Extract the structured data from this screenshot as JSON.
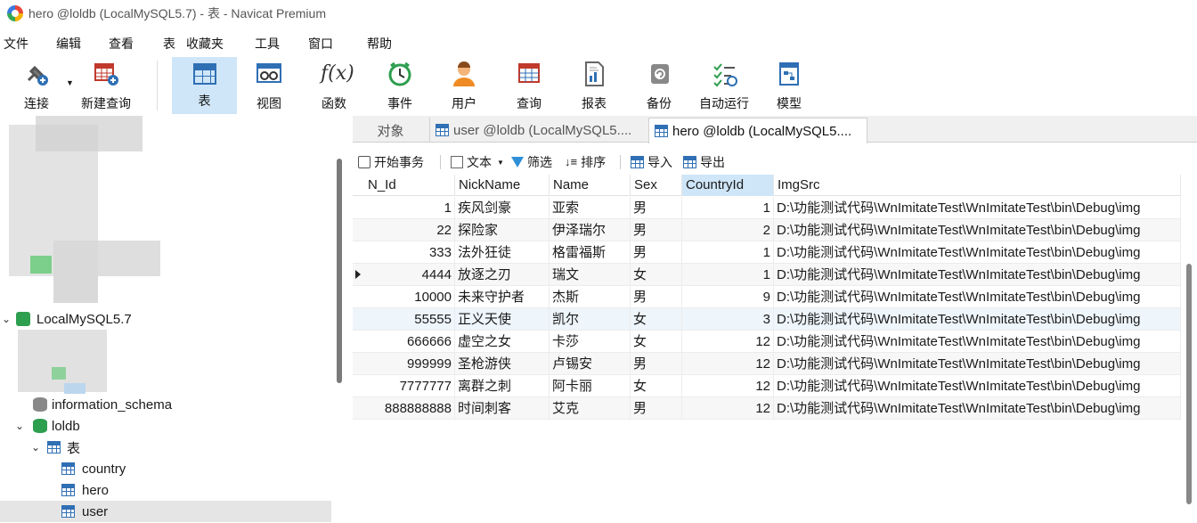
{
  "window": {
    "title": "hero @loldb (LocalMySQL5.7) - 表 - Navicat Premium"
  },
  "menu": [
    "文件",
    "编辑",
    "查看",
    "表",
    "收藏夹",
    "工具",
    "窗口",
    "帮助"
  ],
  "toolbar": [
    {
      "label": "连接",
      "icon": "plug-icon"
    },
    {
      "label": "新建查询",
      "icon": "new-query-icon"
    },
    {
      "label": "表",
      "icon": "table-icon"
    },
    {
      "label": "视图",
      "icon": "view-icon"
    },
    {
      "label": "函数",
      "icon": "function-icon"
    },
    {
      "label": "事件",
      "icon": "clock-icon"
    },
    {
      "label": "用户",
      "icon": "user-icon"
    },
    {
      "label": "查询",
      "icon": "query-icon"
    },
    {
      "label": "报表",
      "icon": "report-icon"
    },
    {
      "label": "备份",
      "icon": "backup-icon"
    },
    {
      "label": "自动运行",
      "icon": "autorun-icon"
    },
    {
      "label": "模型",
      "icon": "model-icon"
    }
  ],
  "tree": {
    "connection": "LocalMySQL5.7",
    "schema1": "information_schema",
    "db": "loldb",
    "tables_folder": "表",
    "tables": [
      "country",
      "hero",
      "user"
    ]
  },
  "tabs": {
    "objects": "对象",
    "tab1": "user @loldb (LocalMySQL5....",
    "tab2": "hero @loldb (LocalMySQL5...."
  },
  "grid_toolbar": {
    "begin_tx": "开始事务",
    "text": "文本",
    "filter": "筛选",
    "sort": "排序",
    "import": "导入",
    "export": "导出"
  },
  "columns": [
    "N_Id",
    "NickName",
    "Name",
    "Sex",
    "CountryId",
    "ImgSrc"
  ],
  "rows": [
    [
      "1",
      "疾风剑豪",
      "亚索",
      "男",
      "1",
      "D:\\功能测试代码\\WnImitateTest\\WnImitateTest\\bin\\Debug\\img"
    ],
    [
      "22",
      "探险家",
      "伊泽瑞尔",
      "男",
      "2",
      "D:\\功能测试代码\\WnImitateTest\\WnImitateTest\\bin\\Debug\\img"
    ],
    [
      "333",
      "法外狂徒",
      "格雷福斯",
      "男",
      "1",
      "D:\\功能测试代码\\WnImitateTest\\WnImitateTest\\bin\\Debug\\img"
    ],
    [
      "4444",
      "放逐之刃",
      "瑞文",
      "女",
      "1",
      "D:\\功能测试代码\\WnImitateTest\\WnImitateTest\\bin\\Debug\\img"
    ],
    [
      "10000",
      "未来守护者",
      "杰斯",
      "男",
      "9",
      "D:\\功能测试代码\\WnImitateTest\\WnImitateTest\\bin\\Debug\\img"
    ],
    [
      "55555",
      "正义天使",
      "凯尔",
      "女",
      "3",
      "D:\\功能测试代码\\WnImitateTest\\WnImitateTest\\bin\\Debug\\img"
    ],
    [
      "666666",
      "虚空之女",
      "卡莎",
      "女",
      "12",
      "D:\\功能测试代码\\WnImitateTest\\WnImitateTest\\bin\\Debug\\img"
    ],
    [
      "999999",
      "圣枪游侠",
      "卢锡安",
      "男",
      "12",
      "D:\\功能测试代码\\WnImitateTest\\WnImitateTest\\bin\\Debug\\img"
    ],
    [
      "7777777",
      "离群之刺",
      "阿卡丽",
      "女",
      "12",
      "D:\\功能测试代码\\WnImitateTest\\WnImitateTest\\bin\\Debug\\img"
    ],
    [
      "888888888",
      "时间刺客",
      "艾克",
      "男",
      "12",
      "D:\\功能测试代码\\WnImitateTest\\WnImitateTest\\bin\\Debug\\img"
    ]
  ],
  "colors": {
    "accent": "#cfe6f8",
    "table_icon": "#2f6fb4",
    "db_green": "#2e9e4f"
  }
}
